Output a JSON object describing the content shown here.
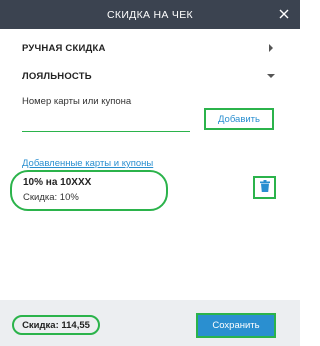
{
  "dialog": {
    "title": "СКИДКА НА ЧЕК"
  },
  "sections": {
    "manual": "РУЧНАЯ СКИДКА",
    "loyalty": "ЛОЯЛЬНОСТЬ"
  },
  "loyalty": {
    "input_label": "Номер карты или купона",
    "input_value": "",
    "add_label": "Добавить",
    "added_link": "Добавленные карты и купоны"
  },
  "coupons": [
    {
      "title": "10% на 10XXX",
      "discount": "Скидка: 10%"
    }
  ],
  "footer": {
    "total": "Скидка: 114,55",
    "save_label": "Сохранить"
  },
  "colors": {
    "header_bg": "#3b4350",
    "accent_blue": "#2a8fd0",
    "highlight_green": "#2bb34b"
  },
  "icons": {
    "close": "close-icon",
    "chevron_right": "chevron-right-icon",
    "chevron_down": "chevron-down-icon",
    "trash": "trash-icon"
  }
}
